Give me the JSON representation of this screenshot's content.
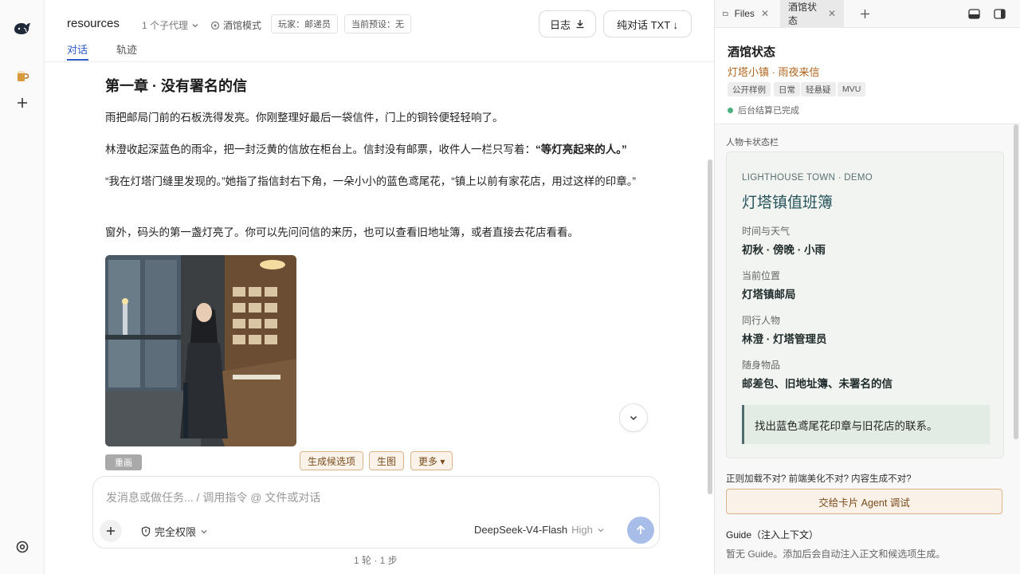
{
  "rail": {
    "icons": [
      "whale-logo-icon",
      "tavern-mug-icon",
      "plus-icon",
      "settings-icon"
    ]
  },
  "header": {
    "project": "resources",
    "agents_label": "1 个子代理",
    "mode_label": "酒馆模式",
    "player_chip": "玩家：邮递员",
    "preset_chip": "当前预设：无",
    "log_button": "日志",
    "export_button": "纯对话 TXT ↓",
    "tabs": [
      {
        "label": "对话",
        "active": true
      },
      {
        "label": "轨迹",
        "active": false
      }
    ]
  },
  "story": {
    "title": "第一章 · 没有署名的信",
    "p1": "雨把邮局门前的石板洗得发亮。你刚整理好最后一袋信件，门上的铜铃便轻轻响了。",
    "p2_prefix": "林澄收起深蓝色的雨伞，把一封泛黄的信放在柜台上。信封没有邮票，收件人一栏只写着：",
    "p2_bold": "“等灯亮起来的人。”",
    "p3": "“我在灯塔门缝里发现的。”她指了指信封右下角，一朵小小的蓝色鸢尾花，“镇上以前有家花店，用过这样的印章。”",
    "p4": "窗外，码头的第一盏灯亮了。你可以先问问信的来历，也可以查看旧地址簿，或者直接去花店看看。",
    "redo_label": "重画",
    "actions": [
      "生成候选项",
      "生图",
      "更多 ▾"
    ]
  },
  "composer": {
    "placeholder": "发消息或做任务... / 调用指令 @ 文件或对话",
    "permission": "完全权限",
    "model": "DeepSeek-V4-Flash",
    "level": "High",
    "footer": "1 轮 · 1 步"
  },
  "right_panel": {
    "tabs": [
      {
        "label": "Files",
        "active": false
      },
      {
        "label": "酒馆状态",
        "active": true
      }
    ],
    "title": "酒馆状态",
    "subtitle": "灯塔小镇 · 雨夜来信",
    "tags": [
      "公开样例",
      "日常",
      "轻悬疑",
      "MVU"
    ],
    "status": "后台结算已完成",
    "section_label": "人物卡状态栏",
    "card": {
      "eyebrow": "LIGHTHOUSE TOWN · DEMO",
      "title": "灯塔镇值班簿",
      "fields": [
        {
          "label": "时间与天气",
          "value": "初秋 · 傍晚 · 小雨"
        },
        {
          "label": "当前位置",
          "value": "灯塔镇邮局"
        },
        {
          "label": "同行人物",
          "value": "林澄 · 灯塔管理员"
        },
        {
          "label": "随身物品",
          "value": "邮差包、旧地址簿、未署名的信"
        }
      ],
      "goal": "找出蓝色鸢尾花印章与旧花店的联系。"
    },
    "debug_question": "正则加载不对? 前端美化不对? 内容生成不对?",
    "debug_button": "交给卡片 Agent 调试",
    "guide_title": "Guide（注入上下文）",
    "guide_text": "暂无 Guide。添加后会自动注入正文和候选项生成。"
  }
}
